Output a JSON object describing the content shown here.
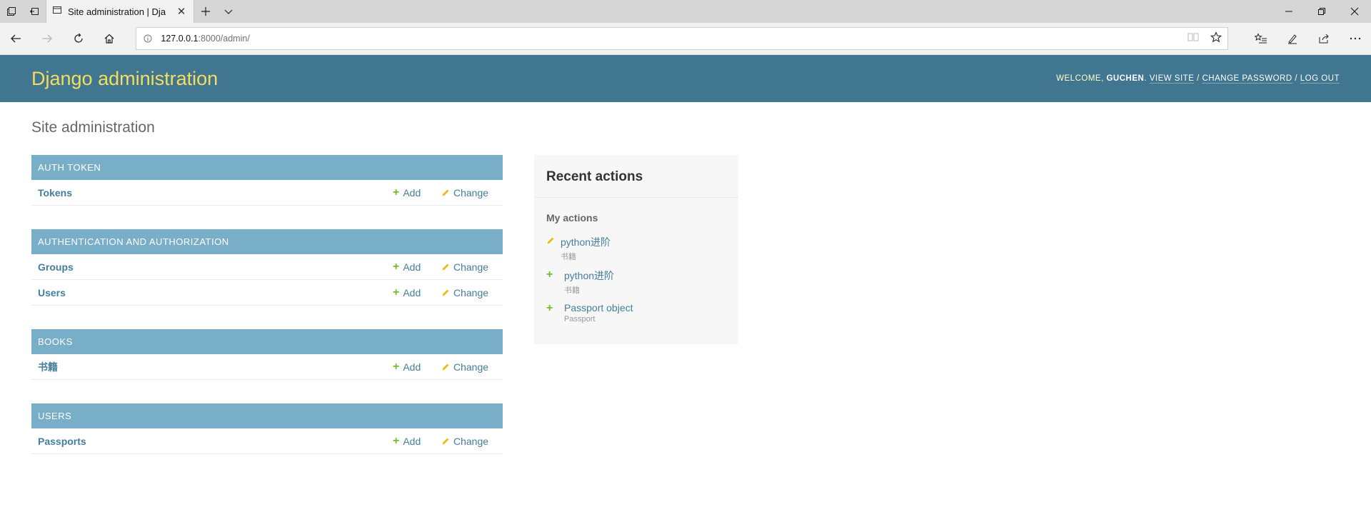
{
  "browser": {
    "tab_title": "Site administration | Dja",
    "url_host": "127.0.0.1",
    "url_path": ":8000/admin/"
  },
  "header": {
    "branding": "Django administration",
    "welcome_label": "WELCOME,",
    "username": "GUCHEN",
    "view_site": "VIEW SITE",
    "change_password": "CHANGE PASSWORD",
    "log_out": "LOG OUT",
    "separator": "/"
  },
  "content": {
    "title": "Site administration",
    "modules": [
      {
        "caption": "AUTH TOKEN",
        "models": [
          {
            "name": "Tokens",
            "add": "Add",
            "change": "Change"
          }
        ]
      },
      {
        "caption": "AUTHENTICATION AND AUTHORIZATION",
        "models": [
          {
            "name": "Groups",
            "add": "Add",
            "change": "Change"
          },
          {
            "name": "Users",
            "add": "Add",
            "change": "Change"
          }
        ]
      },
      {
        "caption": "BOOKS",
        "models": [
          {
            "name": "书籍",
            "add": "Add",
            "change": "Change"
          }
        ]
      },
      {
        "caption": "USERS",
        "models": [
          {
            "name": "Passports",
            "add": "Add",
            "change": "Change"
          }
        ]
      }
    ]
  },
  "recent_actions": {
    "title": "Recent actions",
    "subtitle": "My actions",
    "items": [
      {
        "kind": "change",
        "label": "python进阶",
        "type": "书籍"
      },
      {
        "kind": "add",
        "label": "python进阶",
        "type": "书籍"
      },
      {
        "kind": "add",
        "label": "Passport object",
        "type": "Passport"
      }
    ]
  },
  "colors": {
    "header_bg": "#417690",
    "branding": "#f5dd5d",
    "module_caption_bg": "#79aec8",
    "link": "#447e9b",
    "add_icon": "#70bf2b",
    "change_icon": "#efb80b"
  }
}
